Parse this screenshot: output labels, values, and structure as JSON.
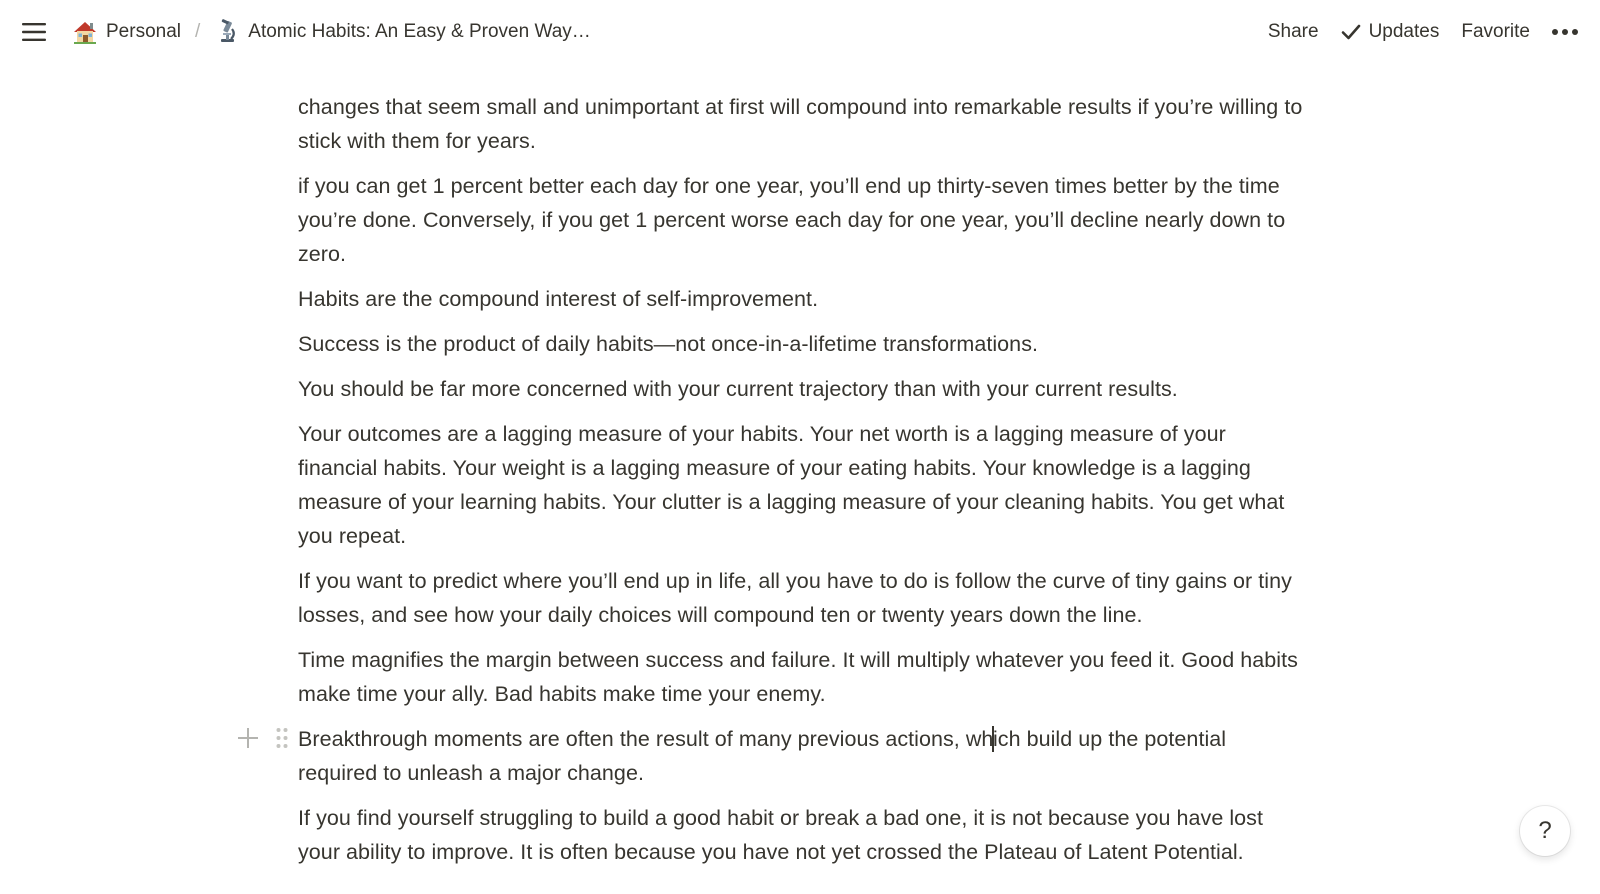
{
  "topbar": {
    "breadcrumbs": [
      {
        "icon": "house-icon",
        "label": "Personal"
      },
      {
        "icon": "microscope-icon",
        "label": "Atomic Habits: An Easy & Proven Way…"
      }
    ],
    "separator": "/",
    "actions": {
      "share": "Share",
      "updates": "Updates",
      "favorite": "Favorite"
    }
  },
  "content": {
    "blocks": [
      "changes that seem small and unimportant at first will compound into remarkable results if you’re willing to stick with them for years.",
      "if you can get 1 percent better each day for one year, you’ll end up thirty-seven times better by the time you’re done. Conversely, if you get 1 percent worse each day for one year, you’ll decline nearly down to zero.",
      "Habits are the compound interest of self-improvement.",
      "Success is the product of daily habits—not once-in-a-lifetime transformations.",
      "You should be far more concerned with your current trajectory than with your current results.",
      "Your outcomes are a lagging measure of your habits. Your net worth is a lagging measure of your financial habits. Your weight is a lagging measure of your eating habits. Your knowledge is a lagging measure of your learning habits. Your clutter is a lagging measure of your cleaning habits. You get what you repeat.",
      "If you want to predict where you’ll end up in life, all you have to do is follow the curve of tiny gains or tiny losses, and see how your daily choices will compound ten or twenty years down the line.",
      "Time magnifies the margin between success and failure. It will multiply whatever you feed it. Good habits make time your ally. Bad habits make time your enemy.",
      "If you find yourself struggling to build a good habit or break a bad one, it is not because you have lost your ability to improve. It is often because you have not yet crossed the Plateau of Latent Potential."
    ],
    "active_block": {
      "before_caret": "Breakthrough moments are often the result of many previous actions, wh",
      "after_caret": "ich build up the potential required to unleash a major change."
    }
  },
  "help": {
    "label": "?"
  },
  "colors": {
    "text": "#37352f",
    "muted": "#b4b4b0"
  }
}
